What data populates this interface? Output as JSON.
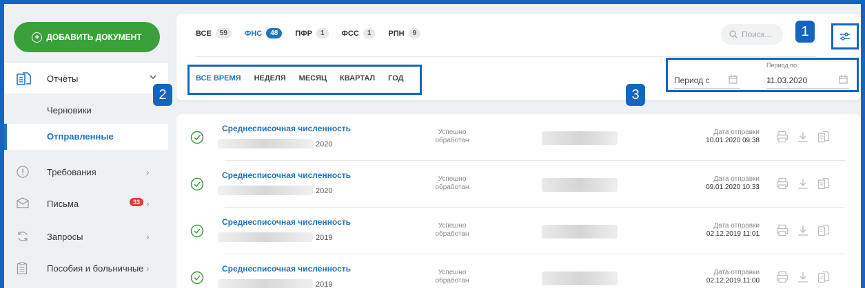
{
  "sidebar": {
    "add_button": "ДОБАВИТЬ ДОКУМЕНТ",
    "reports_label": "Отчёты",
    "sub_items": [
      "Черновики",
      "Отправленные"
    ],
    "items": [
      {
        "label": "Требования"
      },
      {
        "label": "Письма",
        "badge": "33"
      },
      {
        "label": "Запросы"
      },
      {
        "label": "Пособия и больничные"
      }
    ]
  },
  "tabs": [
    {
      "label": "ВСЕ",
      "count": "59"
    },
    {
      "label": "ФНС",
      "count": "48"
    },
    {
      "label": "ПФР",
      "count": "1"
    },
    {
      "label": "ФСС",
      "count": "1"
    },
    {
      "label": "РПН",
      "count": "9"
    }
  ],
  "search": {
    "placeholder": "Поиск..."
  },
  "periods": [
    "ВСЕ ВРЕМЯ",
    "НЕДЕЛЯ",
    "МЕСЯЦ",
    "КВАРТАЛ",
    "ГОД"
  ],
  "date_from": {
    "placeholder": "Период с"
  },
  "date_to": {
    "label": "Период по",
    "value": "11.03.2020"
  },
  "callouts": [
    "1",
    "2",
    "3"
  ],
  "rows": [
    {
      "title": "Среднесписочная численность",
      "year": "2020",
      "status": "Успешно обработан",
      "date_label": "Дата отправки",
      "date": "10.01.2020 09:38"
    },
    {
      "title": "Среднесписочная численность",
      "year": "2020",
      "status": "Успешно обработан",
      "date_label": "Дата отправки",
      "date": "09.01.2020 10:33"
    },
    {
      "title": "Среднесписочная численность",
      "year": "2019",
      "status": "Успешно обработан",
      "date_label": "Дата отправки",
      "date": "02.12.2019 11:01"
    },
    {
      "title": "Среднесписочная численность",
      "year": "2019",
      "status": "Успешно обработан",
      "date_label": "Дата отправки",
      "date": "02.12.2019 11:00"
    }
  ],
  "colors": {
    "accent": "#1e73be",
    "add_button": "#3aa03a",
    "callout": "#1565c0",
    "badge": "#e53935"
  }
}
